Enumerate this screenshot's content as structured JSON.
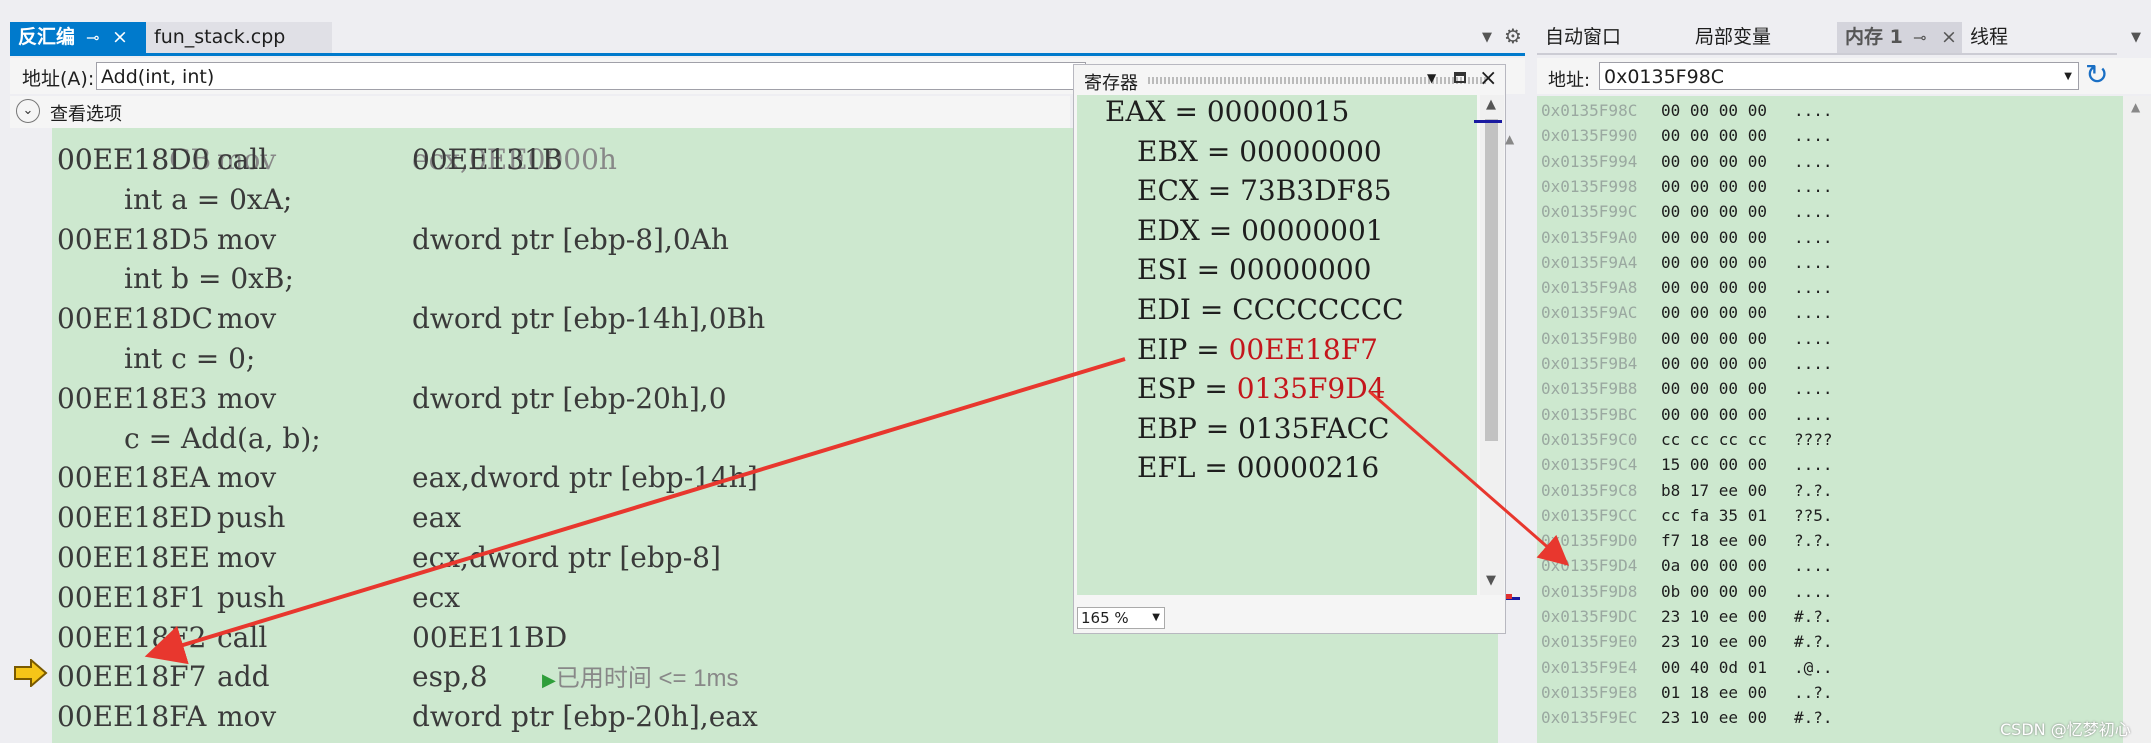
{
  "left_tabs": [
    {
      "label": "反汇编",
      "pin": "⊸",
      "close": "×",
      "active": true
    },
    {
      "label": "fun_stack.cpp",
      "active": false
    }
  ],
  "address": {
    "label": "地址(A):",
    "value": "Add(int, int)"
  },
  "view_options": {
    "label": "查看选项"
  },
  "code_lines": [
    {
      "kind": "asm",
      "addr": "00EE18D0",
      "op": "call",
      "arg": "00EE131B"
    },
    {
      "kind": "src",
      "text": "int a = 0xA;"
    },
    {
      "kind": "asm",
      "addr": "00EE18D5",
      "op": "mov",
      "arg": "dword ptr [ebp-8],0Ah"
    },
    {
      "kind": "src",
      "text": "int b = 0xB;"
    },
    {
      "kind": "asm",
      "addr": "00EE18DC",
      "op": "mov",
      "arg": "dword ptr [ebp-14h],0Bh"
    },
    {
      "kind": "src",
      "text": "int c = 0;"
    },
    {
      "kind": "asm",
      "addr": "00EE18E3",
      "op": "mov",
      "arg": "dword ptr [ebp-20h],0"
    },
    {
      "kind": "src",
      "text": "c = Add(a, b);"
    },
    {
      "kind": "asm",
      "addr": "00EE18EA",
      "op": "mov",
      "arg": "eax,dword ptr [ebp-14h]"
    },
    {
      "kind": "asm",
      "addr": "00EE18ED",
      "op": "push",
      "arg": "eax"
    },
    {
      "kind": "asm",
      "addr": "00EE18EE",
      "op": "mov",
      "arg": "ecx,dword ptr [ebp-8]"
    },
    {
      "kind": "asm",
      "addr": "00EE18F1",
      "op": "push",
      "arg": "ecx"
    },
    {
      "kind": "asm",
      "addr": "00EE18F2",
      "op": "call",
      "arg": "00EE11BD"
    },
    {
      "kind": "asm",
      "addr": "00EE18F7",
      "op": "add",
      "arg": "esp,8",
      "current": true
    },
    {
      "kind": "asm",
      "addr": "00EE18FA",
      "op": "mov",
      "arg": "dword ptr [ebp-20h],eax"
    }
  ],
  "perf_tip": "已用时间 <= 1ms",
  "registers": {
    "title": "寄存器",
    "zoom": "165 %",
    "items": [
      {
        "name": "EAX",
        "value": "00000015",
        "changed": false
      },
      {
        "name": "EBX",
        "value": "00000000",
        "changed": false
      },
      {
        "name": "ECX",
        "value": "73B3DF85",
        "changed": false
      },
      {
        "name": "EDX",
        "value": "00000001",
        "changed": false
      },
      {
        "name": "ESI",
        "value": "00000000",
        "changed": false
      },
      {
        "name": "EDI",
        "value": "CCCCCCCC",
        "changed": false
      },
      {
        "name": "EIP",
        "value": "00EE18F7",
        "changed": true
      },
      {
        "name": "ESP",
        "value": "0135F9D4",
        "changed": true
      },
      {
        "name": "EBP",
        "value": "0135FACC",
        "changed": false
      },
      {
        "name": "EFL",
        "value": "00000216",
        "changed": false
      }
    ]
  },
  "right_tabs": [
    {
      "label": "自动窗口",
      "active": false
    },
    {
      "label": "局部变量",
      "active": false
    },
    {
      "label": "内存 1",
      "pin": "⊸",
      "close": "×",
      "active": true
    },
    {
      "label": "线程",
      "active": false
    }
  ],
  "memory": {
    "address_label": "地址:",
    "address_value": "0x0135F98C",
    "rows": [
      {
        "addr": "0x0135F98C",
        "bytes": "00 00 00 00",
        "ascii": "...."
      },
      {
        "addr": "0x0135F990",
        "bytes": "00 00 00 00",
        "ascii": "...."
      },
      {
        "addr": "0x0135F994",
        "bytes": "00 00 00 00",
        "ascii": "...."
      },
      {
        "addr": "0x0135F998",
        "bytes": "00 00 00 00",
        "ascii": "...."
      },
      {
        "addr": "0x0135F99C",
        "bytes": "00 00 00 00",
        "ascii": "...."
      },
      {
        "addr": "0x0135F9A0",
        "bytes": "00 00 00 00",
        "ascii": "...."
      },
      {
        "addr": "0x0135F9A4",
        "bytes": "00 00 00 00",
        "ascii": "...."
      },
      {
        "addr": "0x0135F9A8",
        "bytes": "00 00 00 00",
        "ascii": "...."
      },
      {
        "addr": "0x0135F9AC",
        "bytes": "00 00 00 00",
        "ascii": "...."
      },
      {
        "addr": "0x0135F9B0",
        "bytes": "00 00 00 00",
        "ascii": "...."
      },
      {
        "addr": "0x0135F9B4",
        "bytes": "00 00 00 00",
        "ascii": "...."
      },
      {
        "addr": "0x0135F9B8",
        "bytes": "00 00 00 00",
        "ascii": "...."
      },
      {
        "addr": "0x0135F9BC",
        "bytes": "00 00 00 00",
        "ascii": "...."
      },
      {
        "addr": "0x0135F9C0",
        "bytes": "cc cc cc cc",
        "ascii": "????"
      },
      {
        "addr": "0x0135F9C4",
        "bytes": "15 00 00 00",
        "ascii": "...."
      },
      {
        "addr": "0x0135F9C8",
        "bytes": "b8 17 ee 00",
        "ascii": "?.?."
      },
      {
        "addr": "0x0135F9CC",
        "bytes": "cc fa 35 01",
        "ascii": "??5."
      },
      {
        "addr": "0x0135F9D0",
        "bytes": "f7 18 ee 00",
        "ascii": "?.?."
      },
      {
        "addr": "0x0135F9D4",
        "bytes": "0a 00 00 00",
        "ascii": "...."
      },
      {
        "addr": "0x0135F9D8",
        "bytes": "0b 00 00 00",
        "ascii": "...."
      },
      {
        "addr": "0x0135F9DC",
        "bytes": "23 10 ee 00",
        "ascii": "#.?."
      },
      {
        "addr": "0x0135F9E0",
        "bytes": "23 10 ee 00",
        "ascii": "#.?."
      },
      {
        "addr": "0x0135F9E4",
        "bytes": "00 40 0d 01",
        "ascii": ".@.."
      },
      {
        "addr": "0x0135F9E8",
        "bytes": "01 18 ee 00",
        "ascii": "..?."
      },
      {
        "addr": "0x0135F9EC",
        "bytes": "23 10 ee 00",
        "ascii": "#.?."
      }
    ]
  },
  "watermark": "CSDN @忆梦初心",
  "colors": {
    "accent": "#007acc",
    "code_bg": "#cde8cf",
    "changed": "#c4161c",
    "annotation_arrow": "#e8372e",
    "ip_arrow": "#f5c518"
  }
}
